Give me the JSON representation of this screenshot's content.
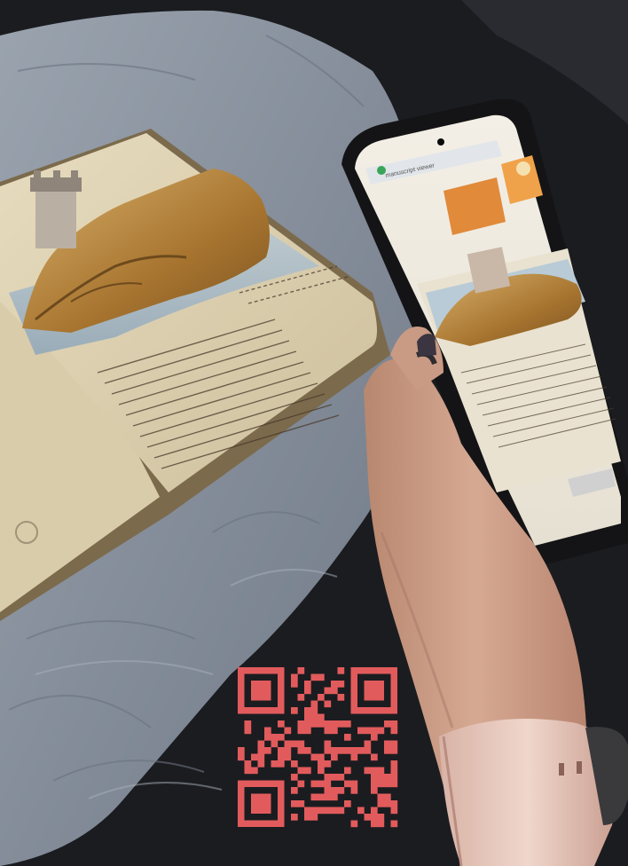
{
  "scene": {
    "background": "#1b1c20",
    "cloth_color": "#8e97a3",
    "parchment_color": "#dcd0b2",
    "ink_color": "#4a3a2a",
    "illustration_rock_color": "#b98a45",
    "sea_color": "#9eb4c6",
    "hand_color": "#c99a84",
    "watch_band_color": "#e8c9bd",
    "qr_color": "#e25b5c"
  },
  "phone": {
    "address_bar_text": "manuscript viewer",
    "screen_content": "augmented view of the manuscript page"
  }
}
